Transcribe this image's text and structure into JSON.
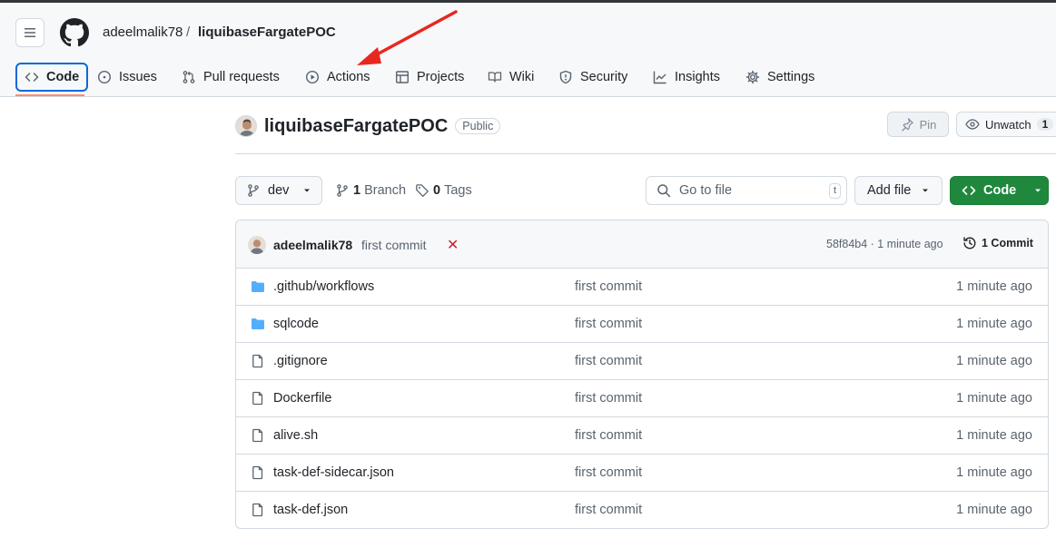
{
  "header": {
    "owner": "adeelmalik78",
    "separator": "/",
    "repo": "liquibaseFargatePOC",
    "tabs": [
      {
        "label": "Code",
        "icon": "code-icon",
        "selected": true
      },
      {
        "label": "Issues",
        "icon": "issue-icon"
      },
      {
        "label": "Pull requests",
        "icon": "pull-request-icon"
      },
      {
        "label": "Actions",
        "icon": "play-icon"
      },
      {
        "label": "Projects",
        "icon": "table-icon"
      },
      {
        "label": "Wiki",
        "icon": "book-icon"
      },
      {
        "label": "Security",
        "icon": "shield-icon"
      },
      {
        "label": "Insights",
        "icon": "graph-icon"
      },
      {
        "label": "Settings",
        "icon": "gear-icon"
      }
    ],
    "annotation_color": "#e8271f"
  },
  "repo": {
    "name": "liquibaseFargatePOC",
    "visibility": "Public",
    "pin_label": "Pin",
    "unwatch_label": "Unwatch",
    "watch_count": "1"
  },
  "toolbar": {
    "branch": "dev",
    "branch_count": "1",
    "branch_label": "Branch",
    "tag_count": "0",
    "tag_label": "Tags",
    "goto_placeholder": "Go to file",
    "goto_shortcut": "t",
    "add_file_label": "Add file",
    "code_label": "Code",
    "code_button_color": "#1f883d"
  },
  "commit": {
    "author": "adeelmalik78",
    "message": "first commit",
    "status": "✕",
    "hash_time": "58f84b4 · 1 minute ago",
    "count_label": "1 Commit"
  },
  "files": [
    {
      "name": ".github/workflows",
      "type": "folder",
      "message": "first commit",
      "time": "1 minute ago"
    },
    {
      "name": "sqlcode",
      "type": "folder",
      "message": "first commit",
      "time": "1 minute ago"
    },
    {
      "name": ".gitignore",
      "type": "file",
      "message": "first commit",
      "time": "1 minute ago"
    },
    {
      "name": "Dockerfile",
      "type": "file",
      "message": "first commit",
      "time": "1 minute ago"
    },
    {
      "name": "alive.sh",
      "type": "file",
      "message": "first commit",
      "time": "1 minute ago"
    },
    {
      "name": "task-def-sidecar.json",
      "type": "file",
      "message": "first commit",
      "time": "1 minute ago"
    },
    {
      "name": "task-def.json",
      "type": "file",
      "message": "first commit",
      "time": "1 minute ago"
    }
  ]
}
